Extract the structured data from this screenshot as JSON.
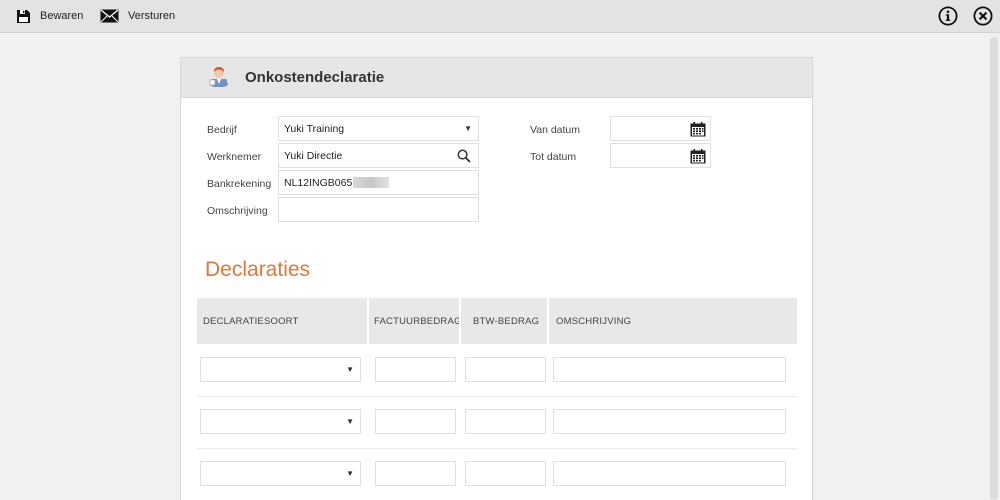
{
  "toolbar": {
    "save_label": "Bewaren",
    "send_label": "Versturen"
  },
  "panel": {
    "title": "Onkostendeclaratie"
  },
  "form": {
    "bedrijf_label": "Bedrijf",
    "bedrijf_value": "Yuki Training",
    "werknemer_label": "Werknemer",
    "werknemer_value": "Yuki Directie",
    "bankrekening_label": "Bankrekening",
    "bankrekening_value": "NL12INGB065",
    "omschrijving_label": "Omschrijving",
    "omschrijving_value": "",
    "van_datum_label": "Van datum",
    "van_datum_value": "",
    "tot_datum_label": "Tot datum",
    "tot_datum_value": ""
  },
  "declaraties": {
    "title": "Declaraties",
    "columns": [
      "DECLARATIESOORT",
      "FACTUURBEDRAG",
      "BTW-BEDRAG",
      "OMSCHRIJVING"
    ]
  },
  "icons": {
    "save": "floppy-disk-icon",
    "send": "envelope-icon",
    "info": "info-icon",
    "close": "close-circle-icon",
    "person": "person-icon",
    "search": "search-icon",
    "calendar": "calendar-icon"
  },
  "colors": {
    "accent": "#e0763a",
    "toolbar": "#e3e3e3",
    "header": "#e6e6e6"
  }
}
